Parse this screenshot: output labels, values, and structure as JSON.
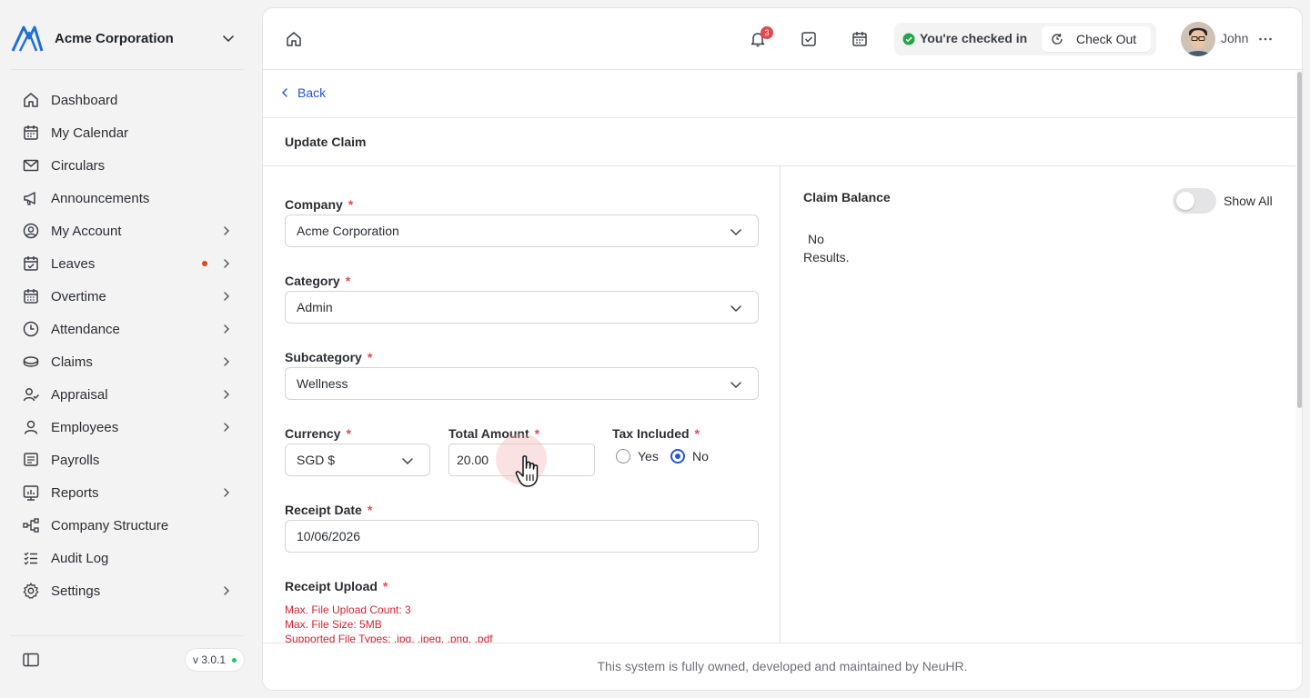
{
  "org": {
    "name": "Acme Corporation"
  },
  "sidebar": {
    "items": [
      {
        "label": "Dashboard",
        "icon": "home-icon",
        "chevron": false,
        "dot": false
      },
      {
        "label": "My Calendar",
        "icon": "calendar-icon",
        "chevron": false,
        "dot": false
      },
      {
        "label": "Circulars",
        "icon": "mail-icon",
        "chevron": false,
        "dot": false
      },
      {
        "label": "Announcements",
        "icon": "megaphone-icon",
        "chevron": false,
        "dot": false
      },
      {
        "label": "My Account",
        "icon": "user-circle-icon",
        "chevron": true,
        "dot": false
      },
      {
        "label": "Leaves",
        "icon": "calendar-check-icon",
        "chevron": true,
        "dot": true
      },
      {
        "label": "Overtime",
        "icon": "calendar-grid-icon",
        "chevron": true,
        "dot": false
      },
      {
        "label": "Attendance",
        "icon": "clock-icon",
        "chevron": true,
        "dot": false
      },
      {
        "label": "Claims",
        "icon": "coins-icon",
        "chevron": true,
        "dot": false
      },
      {
        "label": "Appraisal",
        "icon": "user-check-icon",
        "chevron": true,
        "dot": false
      },
      {
        "label": "Employees",
        "icon": "user-icon",
        "chevron": true,
        "dot": false
      },
      {
        "label": "Payrolls",
        "icon": "receipt-icon",
        "chevron": false,
        "dot": false
      },
      {
        "label": "Reports",
        "icon": "chart-icon",
        "chevron": true,
        "dot": false
      },
      {
        "label": "Company Structure",
        "icon": "hierarchy-icon",
        "chevron": false,
        "dot": false
      },
      {
        "label": "Audit Log",
        "icon": "list-check-icon",
        "chevron": false,
        "dot": false
      },
      {
        "label": "Settings",
        "icon": "gear-icon",
        "chevron": true,
        "dot": false
      }
    ],
    "version": "v 3.0.1"
  },
  "topbar": {
    "notification_count": "3",
    "checkin_status": "You're checked in",
    "checkout_label": "Check Out",
    "user_name": "John"
  },
  "page": {
    "back_label": "Back",
    "title": "Update Claim"
  },
  "form": {
    "company": {
      "label": "Company",
      "required": "*",
      "value": "Acme Corporation"
    },
    "category": {
      "label": "Category",
      "required": "*",
      "value": "Admin"
    },
    "subcategory": {
      "label": "Subcategory",
      "required": "*",
      "value": "Wellness"
    },
    "currency": {
      "label": "Currency",
      "required": "*",
      "value": "SGD $"
    },
    "total_amount": {
      "label": "Total Amount",
      "required": "*",
      "value": "20.00"
    },
    "tax_included": {
      "label": "Tax Included",
      "required": "*",
      "yes": "Yes",
      "no": "No",
      "selected": "No"
    },
    "receipt_date": {
      "label": "Receipt Date",
      "required": "*",
      "value": "10/06/2026"
    },
    "receipt_upload": {
      "label": "Receipt Upload",
      "required": "*",
      "notes": [
        "Max. File Upload Count: 3",
        "Max. File Size: 5MB",
        "Supported File Types: .jpg, .jpeg, .png, .pdf"
      ]
    }
  },
  "claim_balance": {
    "title": "Claim Balance",
    "show_all_label": "Show All",
    "show_all_on": false,
    "empty_text": "No Results."
  },
  "footer": {
    "text": "This system is fully owned, developed and maintained by NeuHR."
  },
  "colors": {
    "accent": "#2455d6",
    "required": "#e5484d",
    "success": "#22c55e",
    "upload_note": "#d1242f"
  }
}
